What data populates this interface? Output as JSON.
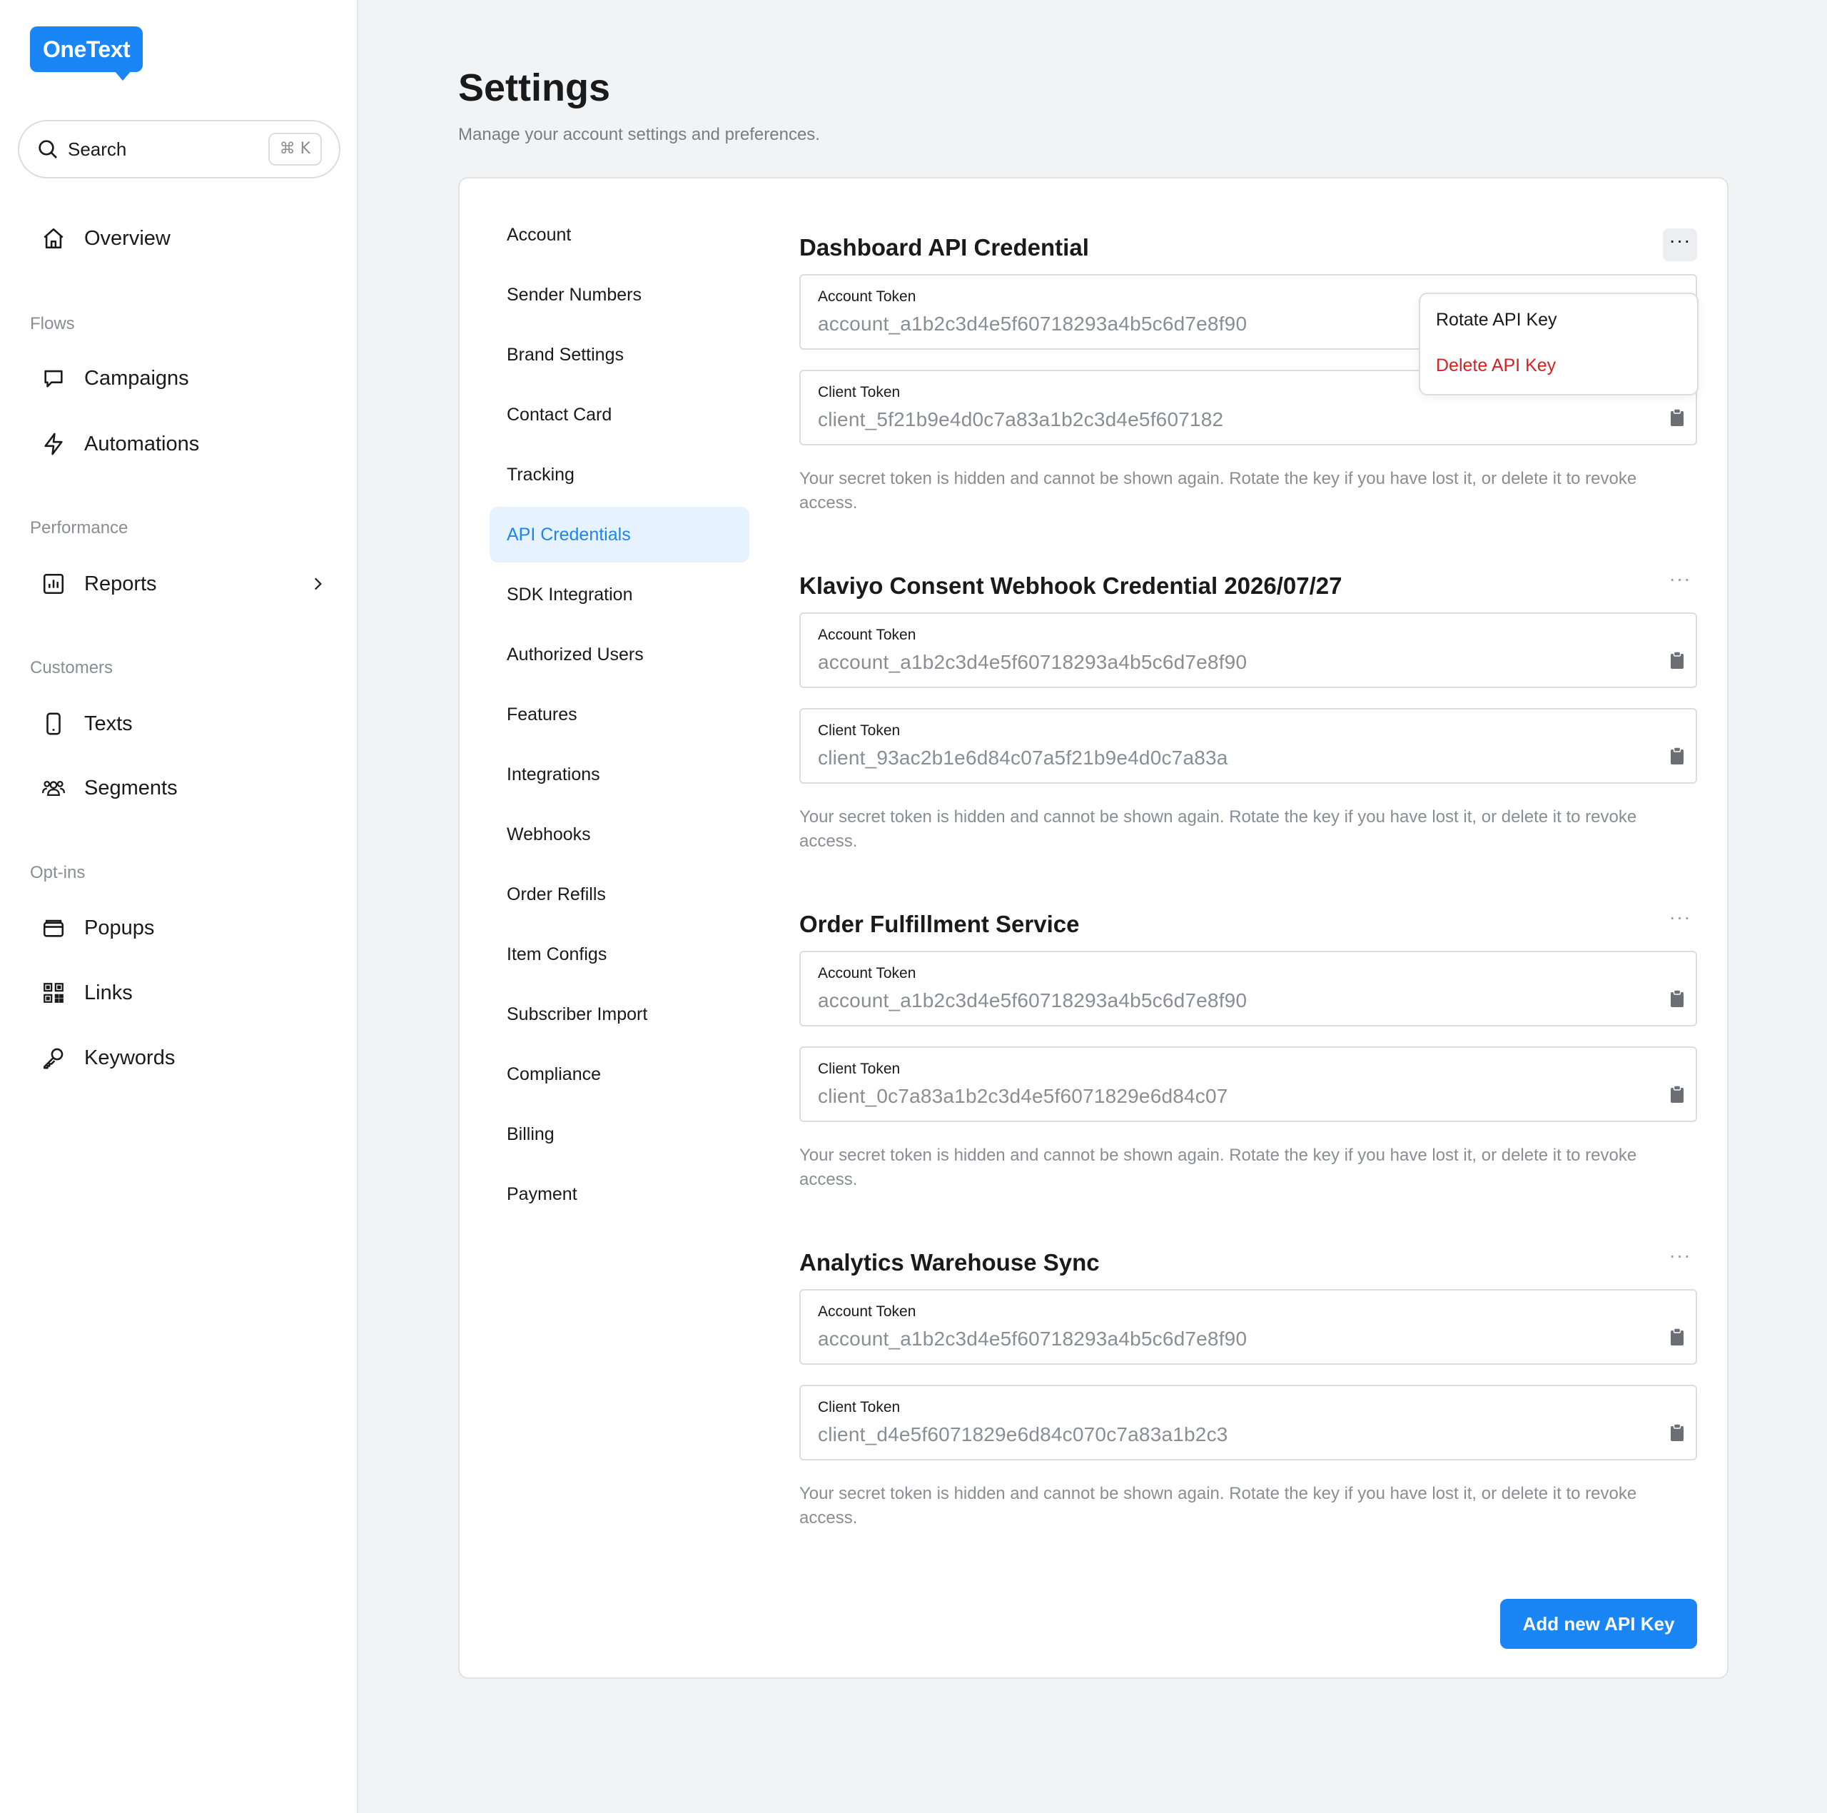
{
  "app": {
    "logo": "OneText",
    "brand_color": "#1a86f5"
  },
  "search": {
    "label": "Search",
    "shortcut": "⌘ K"
  },
  "sidebar": {
    "overview": "Overview",
    "sections": {
      "flows": "Flows",
      "performance": "Performance",
      "customers": "Customers",
      "optins": "Opt-ins"
    },
    "items": {
      "campaigns": "Campaigns",
      "automations": "Automations",
      "reports": "Reports",
      "texts": "Texts",
      "segments": "Segments",
      "popups": "Popups",
      "links": "Links",
      "keywords": "Keywords"
    }
  },
  "page": {
    "title": "Settings",
    "subtitle": "Manage your account settings and preferences."
  },
  "settings_nav": [
    "Account",
    "Sender Numbers",
    "Brand Settings",
    "Contact Card",
    "Tracking",
    "API Credentials",
    "SDK Integration",
    "Authorized Users",
    "Features",
    "Integrations",
    "Webhooks",
    "Order Refills",
    "Item Configs",
    "Subscriber Import",
    "Compliance",
    "Billing",
    "Payment"
  ],
  "settings_nav_active": "API Credentials",
  "credentials": [
    {
      "title": "Dashboard API Credential",
      "account_label": "Account Token",
      "account_value": "account_a1b2c3d4e5f60718293a4b5c6d7e8f90",
      "client_label": "Client Token",
      "client_value": "client_5f21b9e4d0c7a83a1b2c3d4e5f607182",
      "note": "Your secret token is hidden and cannot be shown again. Rotate the key if you have lost it, or delete it to revoke access."
    },
    {
      "title": "Klaviyo Consent Webhook Credential 2026/07/27",
      "account_label": "Account Token",
      "account_value": "account_a1b2c3d4e5f60718293a4b5c6d7e8f90",
      "client_label": "Client Token",
      "client_value": "client_93ac2b1e6d84c07a5f21b9e4d0c7a83a",
      "note": "Your secret token is hidden and cannot be shown again. Rotate the key if you have lost it, or delete it to revoke access."
    },
    {
      "title": "Order Fulfillment Service",
      "account_label": "Account Token",
      "account_value": "account_a1b2c3d4e5f60718293a4b5c6d7e8f90",
      "client_label": "Client Token",
      "client_value": "client_0c7a83a1b2c3d4e5f6071829e6d84c07",
      "note": "Your secret token is hidden and cannot be shown again. Rotate the key if you have lost it, or delete it to revoke access."
    },
    {
      "title": "Analytics Warehouse Sync",
      "account_label": "Account Token",
      "account_value": "account_a1b2c3d4e5f60718293a4b5c6d7e8f90",
      "client_label": "Client Token",
      "client_value": "client_d4e5f6071829e6d84c070c7a83a1b2c3",
      "note": "Your secret token is hidden and cannot be shown again. Rotate the key if you have lost it, or delete it to revoke access."
    }
  ],
  "dropdown": {
    "rotate": "Rotate API Key",
    "delete": "Delete API Key",
    "delete_color": "#d42222"
  },
  "add_button": "Add new API Key",
  "icons": {
    "search": "search-icon",
    "home": "home-icon",
    "chat": "chat-bubble-icon",
    "bolt": "lightning-icon",
    "chart": "bar-chart-icon",
    "phone": "phone-icon",
    "users": "users-icon",
    "popup": "popup-icon",
    "qr": "qr-code-icon",
    "key": "key-icon",
    "chevron": "chevron-right-icon",
    "clipboard": "clipboard-icon",
    "more": "more-horizontal-icon"
  }
}
